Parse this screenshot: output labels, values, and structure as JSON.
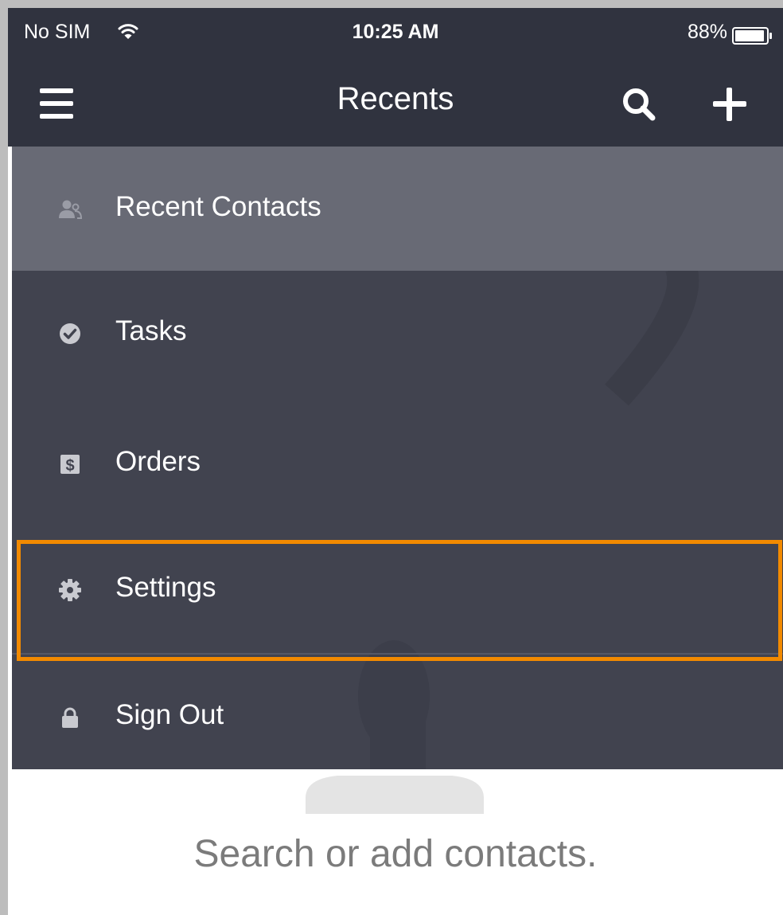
{
  "status_bar": {
    "carrier": "No SIM",
    "time": "10:25 AM",
    "battery": "88%"
  },
  "nav_bar": {
    "title": "Recents"
  },
  "menu": {
    "items": [
      {
        "label": "Recent Contacts",
        "icon": "contacts-icon",
        "active": true
      },
      {
        "label": "Tasks",
        "icon": "check-circle-icon",
        "active": false
      },
      {
        "label": "Orders",
        "icon": "dollar-icon",
        "active": false,
        "highlighted": true
      },
      {
        "label": "Settings",
        "icon": "gear-icon",
        "active": false
      },
      {
        "label": "Sign Out",
        "icon": "lock-icon",
        "active": false
      }
    ]
  },
  "empty_state": {
    "message": "Search or add contacts."
  },
  "colors": {
    "header_bg": "#30333f",
    "drawer_bg": "#41434f",
    "active_item_bg": "#686a75",
    "highlight": "#f28a00",
    "icon_gray": "#9a9ca6"
  }
}
